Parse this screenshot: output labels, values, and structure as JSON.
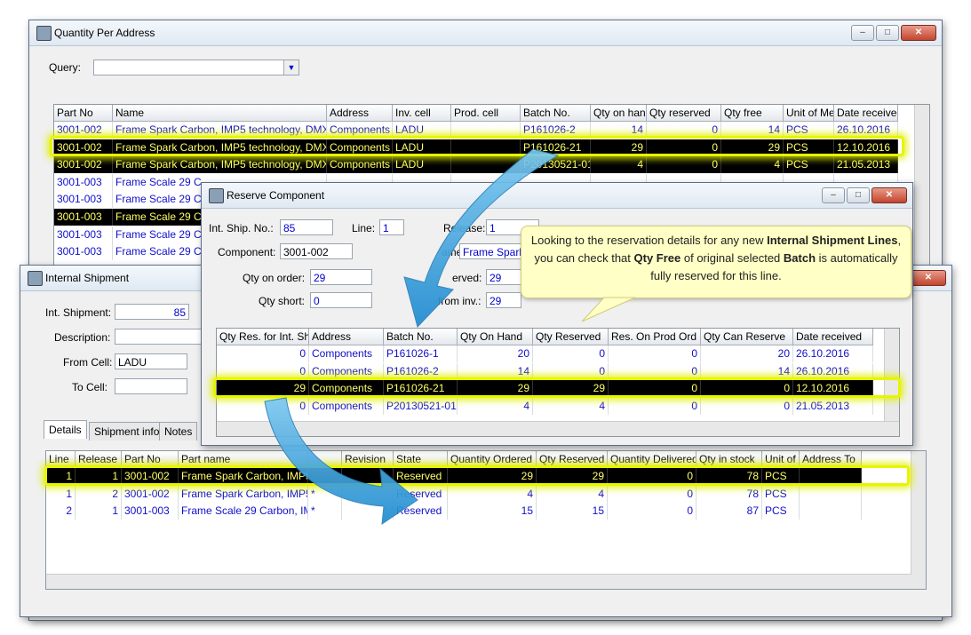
{
  "qpa": {
    "title": "Quantity Per Address",
    "query_label": "Query:",
    "query_value": "",
    "columns": [
      "Part No",
      "Name",
      "Address",
      "Inv. cell",
      "Prod. cell",
      "Batch No.",
      "Qty on han",
      "Qty reserved",
      "Qty free",
      "Unit of Me",
      "Date received"
    ],
    "rows": [
      [
        "3001-002",
        "Frame Spark Carbon, IMP5 technology, DMX",
        "Components",
        "LADU",
        "",
        "P161026-2",
        "14",
        "0",
        "14",
        "PCS",
        "26.10.2016"
      ],
      [
        "3001-002",
        "Frame Spark Carbon, IMP5 technology, DMX",
        "Components",
        "LADU",
        "",
        "P161026-21",
        "29",
        "0",
        "29",
        "PCS",
        "12.10.2016"
      ],
      [
        "3001-002",
        "Frame Spark Carbon, IMP5 technology, DMX",
        "Components",
        "LADU",
        "",
        "P20130521-01",
        "4",
        "0",
        "4",
        "PCS",
        "21.05.2013"
      ],
      [
        "3001-003",
        "Frame Scale 29 C",
        "",
        "",
        "",
        "",
        "",
        "",
        "",
        "",
        ""
      ],
      [
        "3001-003",
        "Frame Scale 29 C",
        "",
        "",
        "",
        "",
        "",
        "",
        "",
        "",
        ""
      ],
      [
        "3001-003",
        "Frame Scale 29 C",
        "",
        "",
        "",
        "",
        "",
        "",
        "",
        "",
        ""
      ],
      [
        "3001-003",
        "Frame Scale 29 C",
        "",
        "",
        "",
        "",
        "",
        "",
        "",
        "",
        ""
      ],
      [
        "3001-003",
        "Frame Scale 29 C",
        "",
        "",
        "",
        "",
        "",
        "",
        "",
        "",
        ""
      ]
    ]
  },
  "reserve": {
    "title": "Reserve Component",
    "int_ship_no_label": "Int. Ship. No.:",
    "int_ship_no": "85",
    "line_label": "Line:",
    "line": "1",
    "release_label": "Release:",
    "release": "1",
    "component_label": "Component:",
    "component": "3001-002",
    "name_label": "ame:",
    "name": "Frame Spark",
    "qty_on_order_label": "Qty on order:",
    "qty_on_order": "29",
    "reserved_label": "erved:",
    "reserved": "29",
    "qty_short_label": "Qty short:",
    "qty_short": "0",
    "from_inv_label": "from inv.:",
    "from_inv": "29",
    "columns": [
      "Qty Res. for Int. Sh",
      "Address",
      "Batch No.",
      "Qty On Hand",
      "Qty Reserved",
      "Res. On Prod Ord",
      "Qty Can Reserve",
      "Date received"
    ],
    "rows": [
      [
        "0",
        "Components",
        "P161026-1",
        "20",
        "0",
        "0",
        "20",
        "26.10.2016"
      ],
      [
        "0",
        "Components",
        "P161026-2",
        "14",
        "0",
        "0",
        "14",
        "26.10.2016"
      ],
      [
        "29",
        "Components",
        "P161026-21",
        "29",
        "29",
        "0",
        "0",
        "12.10.2016"
      ],
      [
        "0",
        "Components",
        "P20130521-01",
        "4",
        "4",
        "0",
        "0",
        "21.05.2013"
      ]
    ]
  },
  "internal": {
    "title": "Internal Shipment",
    "int_shipment_label": "Int. Shipment:",
    "int_shipment": "85",
    "description_label": "Description:",
    "description": "",
    "from_cell_label": "From Cell:",
    "from_cell": "LADU",
    "to_cell_label": "To Cell:",
    "to_cell": "",
    "tabs": [
      "Details",
      "Shipment info",
      "Notes"
    ],
    "columns": [
      "Line",
      "Release",
      "Part No",
      "Part name",
      "",
      "Revision",
      "State",
      "Quantity Ordered",
      "Qty Reserved",
      "Quantity Delivered",
      "Qty in stock",
      "Unit of",
      "Address To"
    ],
    "rows": [
      [
        "1",
        "1",
        "3001-002",
        "Frame Spark Carbon, IMP5",
        "",
        "",
        "Reserved",
        "29",
        "29",
        "0",
        "78",
        "PCS",
        ""
      ],
      [
        "1",
        "2",
        "3001-002",
        "Frame Spark Carbon, IMP5",
        "*",
        "",
        "Reserved",
        "4",
        "4",
        "0",
        "78",
        "PCS",
        ""
      ],
      [
        "2",
        "1",
        "3001-003",
        "Frame Scale 29 Carbon, IMI",
        "*",
        "",
        "Reserved",
        "15",
        "15",
        "0",
        "87",
        "PCS",
        ""
      ]
    ]
  },
  "callout": {
    "t1": "Looking to the reservation details for any new ",
    "b1": "Internal Shipment Lines",
    "t2": ", you can check that ",
    "b2": "Qty Free",
    "t3": " of original selected ",
    "b3": "Batch",
    "t4": " is automatically fully reserved for this line."
  },
  "colors": {
    "highlight": "#e8f400",
    "arrow": "#3aa7e0",
    "link_text": "#1010c8",
    "selected_row_text": "#ffff66"
  }
}
